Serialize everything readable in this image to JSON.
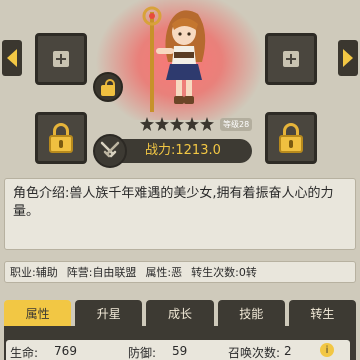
{
  "hero": {
    "level_badge": "等级28",
    "power_label": "战力:",
    "power_value": "1213.0",
    "stars_filled": 5
  },
  "description": {
    "label": "角色介绍:",
    "text": "兽人族千年难遇的美少女,拥有着振奋人心的力量。"
  },
  "info": {
    "job_label": "职业:",
    "job_value": "辅助",
    "camp_label": "阵营:",
    "camp_value": "自由联盟",
    "attr_label": "属性:",
    "attr_value": "恶",
    "rebirth_label": "转生次数:",
    "rebirth_value": "0转"
  },
  "tabs": [
    {
      "label": "属性",
      "active": true
    },
    {
      "label": "升星",
      "active": false
    },
    {
      "label": "成长",
      "active": false
    },
    {
      "label": "技能",
      "active": false
    },
    {
      "label": "转生",
      "active": false
    }
  ],
  "stats": {
    "hp_label": "生命:",
    "hp_value": "769",
    "def_label": "防御:",
    "def_value": "59",
    "summon_label": "召唤次数:",
    "summon_value": "2"
  },
  "info_icon": "i",
  "colors": {
    "accent": "#f2c744",
    "dark": "#3d3a33",
    "panel": "#e9e6dc",
    "background": "#cfcabb",
    "spotlight": "#f06060"
  }
}
